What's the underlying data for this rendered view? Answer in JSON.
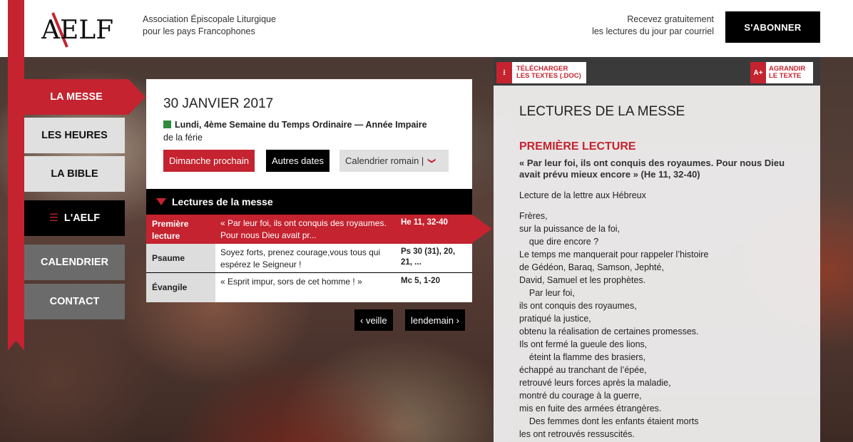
{
  "header": {
    "logo_text": "AELF",
    "tagline_line1": "Association Épiscopale Liturgique",
    "tagline_line2": "pour les pays Francophones",
    "subscribe_line1": "Recevez gratuitement",
    "subscribe_line2": "les lectures du jour par courriel",
    "subscribe_button": "S'ABONNER"
  },
  "nav": {
    "messe": "LA MESSE",
    "heures": "LES HEURES",
    "bible": "LA BIBLE",
    "aelf": "L'AELF",
    "calendrier": "CALENDRIER",
    "contact": "CONTACT"
  },
  "day": {
    "date": "30 JANVIER 2017",
    "liturgy_bold": "Lundi, 4ème Semaine du Temps Ordinaire — Année Impaire",
    "liturgy_rest": "de la férie",
    "btn_dimanche": "Dimanche prochain",
    "btn_autres": "Autres dates",
    "btn_calendrier": "Calendrier romain |",
    "liturgical_color": "#2e8b3e"
  },
  "readings": {
    "heading": "Lectures de la messe",
    "rows": [
      {
        "name": "Première lecture",
        "text": "« Par leur foi, ils ont conquis des royaumes. Pour nous Dieu avait pr...",
        "ref": "He 11, 32-40"
      },
      {
        "name": "Psaume",
        "text": "Soyez forts, prenez courage,vous tous qui espérez le Seigneur !",
        "ref": "Ps 30 (31), 20, 21, ..."
      },
      {
        "name": "Évangile",
        "text": "« Esprit impur, sors de cet homme ! »",
        "ref": "Mc 5, 1-20"
      }
    ],
    "prev": "‹ veille",
    "next": "lendemain ›"
  },
  "textpanel": {
    "download_line1": "TÉLÉCHARGER",
    "download_line2": "LES TEXTES (.DOC)",
    "zoom_icon": "A+",
    "zoom_line1": "AGRANDIR",
    "zoom_line2": "LE TEXTE",
    "title": "LECTURES DE LA MESSE",
    "reading_title": "PREMIÈRE LECTURE",
    "antienne": "« Par leur foi, ils ont conquis des royaumes. Pour nous Dieu avait prévu mieux encore » (He 11, 32-40)",
    "intro": "Lecture de la lettre aux Hébreux",
    "lines": [
      "Frères,",
      "sur la puissance de la foi,",
      "    que dire encore ?",
      "Le temps me manquerait pour rappeler l’histoire",
      "de Gédéon, Baraq, Samson, Jephté,",
      "David, Samuel et les prophètes.",
      "    Par leur foi,",
      "ils ont conquis des royaumes,",
      "pratiqué la justice,",
      "obtenu la réalisation de certaines promesses.",
      "Ils ont fermé la gueule des lions,",
      "    éteint la flamme des brasiers,",
      "échappé au tranchant de l’épée,",
      "retrouvé leurs forces après la maladie,",
      "montré du courage à la guerre,",
      "mis en fuite des armées étrangères.",
      "    Des femmes dont les enfants étaient morts",
      "les ont retrouvés ressuscités."
    ]
  },
  "colors": {
    "accent": "#c4232f",
    "dark": "#000000",
    "gray": "#6b6b6b"
  }
}
